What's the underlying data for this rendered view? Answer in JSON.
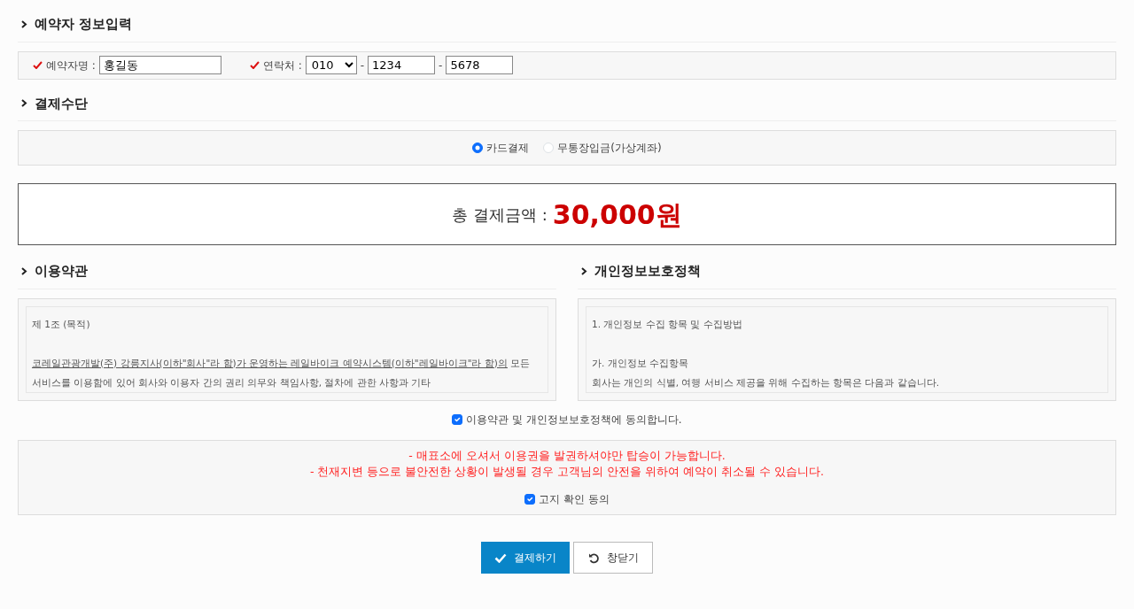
{
  "booker_section": {
    "title": "예약자 정보입력",
    "name_label": "예약자명 :",
    "name_value": "홍길동",
    "phone_label": "연락처 :",
    "phone_prefix": "010",
    "phone_sep1": "-",
    "phone_middle": "1234",
    "phone_sep2": "-",
    "phone_last": "5678"
  },
  "payment_section": {
    "title": "결제수단",
    "methods": [
      {
        "label": "카드결제",
        "selected": true
      },
      {
        "label": "무통장입금(가상계좌)",
        "selected": false
      }
    ]
  },
  "total": {
    "label": "총 결제금액 :",
    "amount": "30,000원"
  },
  "terms": {
    "title": "이용약관",
    "heading": "제 1조 (목적)",
    "underlined": "코레일관광개발(주) 강릉지사(이하\"회사\"라 함)가 운영하는 레일바이크 예약시스템(이하\"레일바이크\"라 함)의",
    "rest": " 모든 서비스를 이용함에 있어 회사와 이용자 간의 권리 의무와 책임사항, 절차에 관한 사항과 기타"
  },
  "privacy": {
    "title": "개인정보보호정책",
    "paragraphs": [
      [
        "1. 개인정보 수집 항목 및 수집방법"
      ],
      [
        "가. 개인정보 수집항목",
        "회사는 개인의 식별, 여행 서비스 제공을 위해 수집하는 항목은 다음과 같습니다."
      ]
    ]
  },
  "agree_terms": {
    "label": "이용약관 및 개인정보보호정책에 동의합니다.",
    "checked": true
  },
  "notice": {
    "lines": [
      "- 매표소에 오셔서 이용권을 발권하셔야만 탑승이 가능합니다.",
      "- 천재지변 등으로 불안전한 상황이 발생될 경우 고객님의 안전을 위하여 예약이 취소될 수 있습니다."
    ],
    "confirm": {
      "label": "고지 확인 동의",
      "checked": true
    }
  },
  "buttons": [
    {
      "kind": "primary",
      "label": "결제하기"
    },
    {
      "kind": "secondary",
      "label": "창닫기"
    }
  ]
}
